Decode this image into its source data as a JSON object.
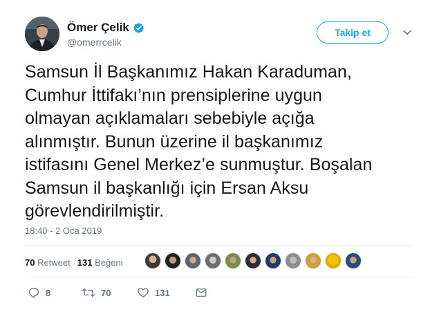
{
  "author": {
    "display_name": "Ömer Çelik",
    "handle": "@omerrcelik",
    "verified": true
  },
  "follow_button": {
    "label": "Takip et"
  },
  "tweet": {
    "text_lines": [
      "Samsun İl Başkanımız Hakan Karaduman,",
      "Cumhur İttifakı’nın prensiplerine uygun",
      "olmayan açıklamaları sebebiyle açığa",
      "alınmıştır. Bunun üzerine il başkanımız",
      "istifasını Genel Merkez’e sunmuştur. Boşalan",
      "Samsun il başkanlığı için Ersan Aksu",
      "görevlendirilmiştir."
    ],
    "timestamp": "18:40 - 2 Oca 2019"
  },
  "stats": {
    "retweet_count": "70",
    "retweet_label": "Retweet",
    "like_count": "131",
    "like_label": "Beğeni"
  },
  "likers": [
    "liker-1",
    "liker-2",
    "liker-3",
    "liker-4",
    "liker-5",
    "liker-6",
    "liker-7",
    "liker-8",
    "liker-9",
    "liker-10",
    "liker-11"
  ],
  "actions": {
    "reply_count": "8",
    "retweet_count": "70",
    "like_count": "131"
  },
  "colors": {
    "accent": "#1da1f2",
    "muted": "#657786",
    "text": "#14171a",
    "divider": "#e6ecf0"
  }
}
